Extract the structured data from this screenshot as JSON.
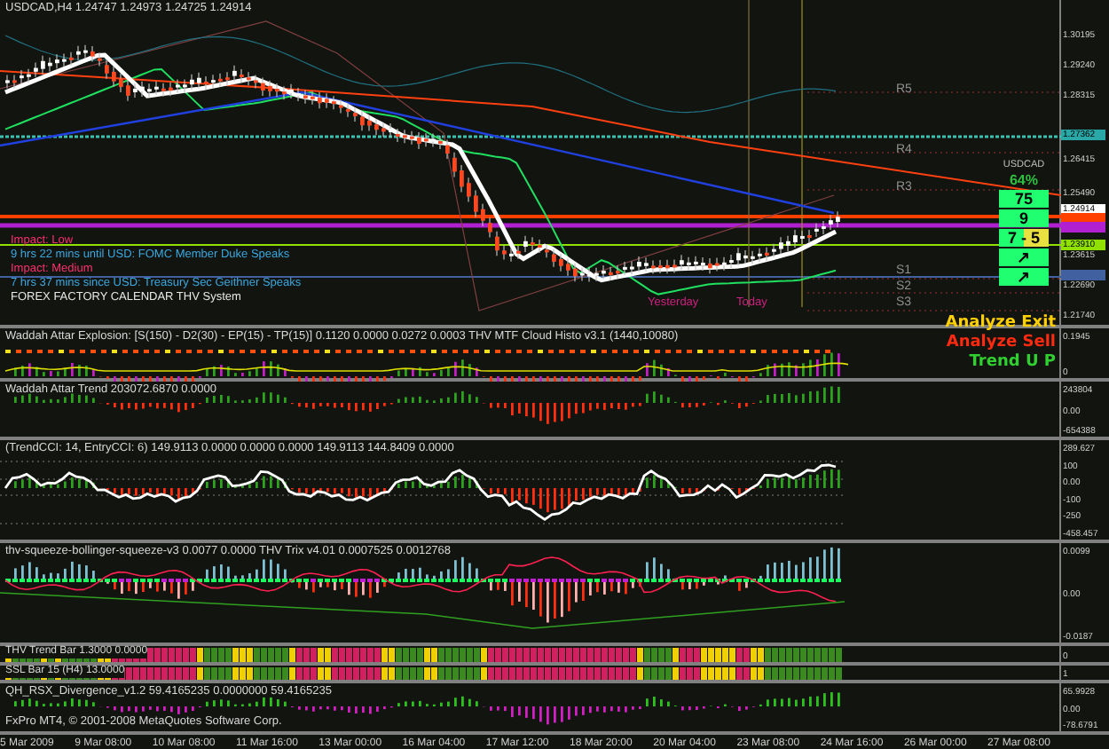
{
  "chart": {
    "title": "USDCAD,H4  1.24747 1.24973 1.24725 1.24914"
  },
  "news": [
    {
      "kind": "impact",
      "text": "Impact: Low"
    },
    {
      "kind": "event",
      "text": "9 hrs 22 mins until USD: FOMC Member Duke Speaks"
    },
    {
      "kind": "impact",
      "text": "Impact: Medium"
    },
    {
      "kind": "event",
      "text": "7 hrs 37 mins since USD: Treasury Sec Geithner Speaks"
    },
    {
      "kind": "footer",
      "text": "FOREX FACTORY CALENDAR THV System"
    }
  ],
  "pivots": [
    {
      "label": "R5"
    },
    {
      "label": "R4"
    },
    {
      "label": "R3"
    },
    {
      "label": "S1"
    },
    {
      "label": "S2"
    },
    {
      "label": "S3"
    }
  ],
  "day_labels": [
    {
      "text": "Yesterday"
    },
    {
      "text": "Today"
    }
  ],
  "signal_panel": {
    "symbol": "USDCAD",
    "percent": "64%",
    "rows": [
      {
        "kind": "number",
        "text": "75"
      },
      {
        "kind": "number",
        "text": "9"
      },
      {
        "kind": "split",
        "text": "7 - 5"
      },
      {
        "kind": "arrow",
        "text": "↗"
      },
      {
        "kind": "arrow",
        "text": "↗"
      }
    ]
  },
  "signals": [
    {
      "text": "Analyze Exit",
      "color": "#ffd000"
    },
    {
      "text": "Analyze Sell",
      "color": "#ff2a10"
    },
    {
      "text": "Trend U P",
      "color": "#30d030"
    }
  ],
  "price_axis": [
    {
      "text": "1.30195"
    },
    {
      "text": "1.29240"
    },
    {
      "text": "1.28315"
    },
    {
      "text": "1.26415"
    },
    {
      "text": "1.25490"
    },
    {
      "text": "1.23615"
    },
    {
      "text": "1.22690"
    },
    {
      "text": "1.21740"
    }
  ],
  "price_tags": [
    {
      "text": "1.27362",
      "color": "#2aa8a8"
    },
    {
      "text": "1.24914",
      "color": "#ffffff"
    },
    {
      "color": "#ff4000"
    },
    {
      "color": "#b020d0"
    },
    {
      "text": "1.23910",
      "color": "#90e000"
    },
    {
      "color": "#4060a0"
    }
  ],
  "panes": [
    {
      "kind": "explosion",
      "label": "Waddah Attar Explosion: [S(150) - D2(30) - EP(15) - TP(15)] 0.1120 0.0000 0.0272 0.0003  THV MTF Cloud Histo v3.1 (1440,10080)",
      "axis": [
        {
          "text": "0.1945"
        },
        {
          "text": "0"
        }
      ]
    },
    {
      "kind": "trend",
      "label": "Waddah Attar Trend 203072.6870 0.0000",
      "axis": [
        {
          "text": "243804"
        },
        {
          "text": "0.00"
        },
        {
          "text": "-654388"
        }
      ]
    },
    {
      "kind": "cci",
      "label": "(TrendCCI: 14, EntryCCI: 6)  149.9113 0.0000 0.0000 0.0000 149.9113 144.8409 0.0000",
      "axis": [
        {
          "text": "289.627"
        },
        {
          "text": "100"
        },
        {
          "text": "0.00"
        },
        {
          "text": "-100"
        },
        {
          "text": "-250"
        },
        {
          "text": "-458.457"
        }
      ]
    },
    {
      "kind": "squeeze",
      "label": "thv-squeeze-bollinger-squeeze-v3 0.0077 0.0000  THV Trix v4.01 0.0007525 0.0012768",
      "axis": [
        {
          "text": "0.0099"
        },
        {
          "text": "0.00"
        },
        {
          "text": "-0.0187"
        }
      ]
    },
    {
      "kind": "trendbar",
      "label": "THV Trend Bar 1.3000 0.0000",
      "axis": [
        {
          "text": "0"
        }
      ]
    },
    {
      "kind": "ssl",
      "label": "SSL Bar 15 (H4) 13.0000",
      "axis": [
        {
          "text": "1"
        }
      ]
    },
    {
      "kind": "rsx",
      "label": "QH_RSX_Divergence_v1.2 59.4165235 0.0000000 59.4165235",
      "footer": "FxPro MT4, © 2001-2008 MetaQuotes Software Corp.",
      "axis": [
        {
          "text": "65.9928"
        },
        {
          "text": "0.00"
        },
        {
          "text": "-78.6791"
        }
      ]
    }
  ],
  "time_axis": [
    {
      "text": "5 Mar 2009"
    },
    {
      "text": "9 Mar 08:00"
    },
    {
      "text": "10 Mar 08:00"
    },
    {
      "text": "11 Mar 16:00"
    },
    {
      "text": "13 Mar 00:00"
    },
    {
      "text": "16 Mar 04:00"
    },
    {
      "text": "17 Mar 12:00"
    },
    {
      "text": "18 Mar 20:00"
    },
    {
      "text": "20 Mar 04:00"
    },
    {
      "text": "23 Mar 08:00"
    },
    {
      "text": "24 Mar 16:00"
    },
    {
      "text": "26 Mar 00:00"
    },
    {
      "text": "27 Mar 08:00"
    }
  ]
}
